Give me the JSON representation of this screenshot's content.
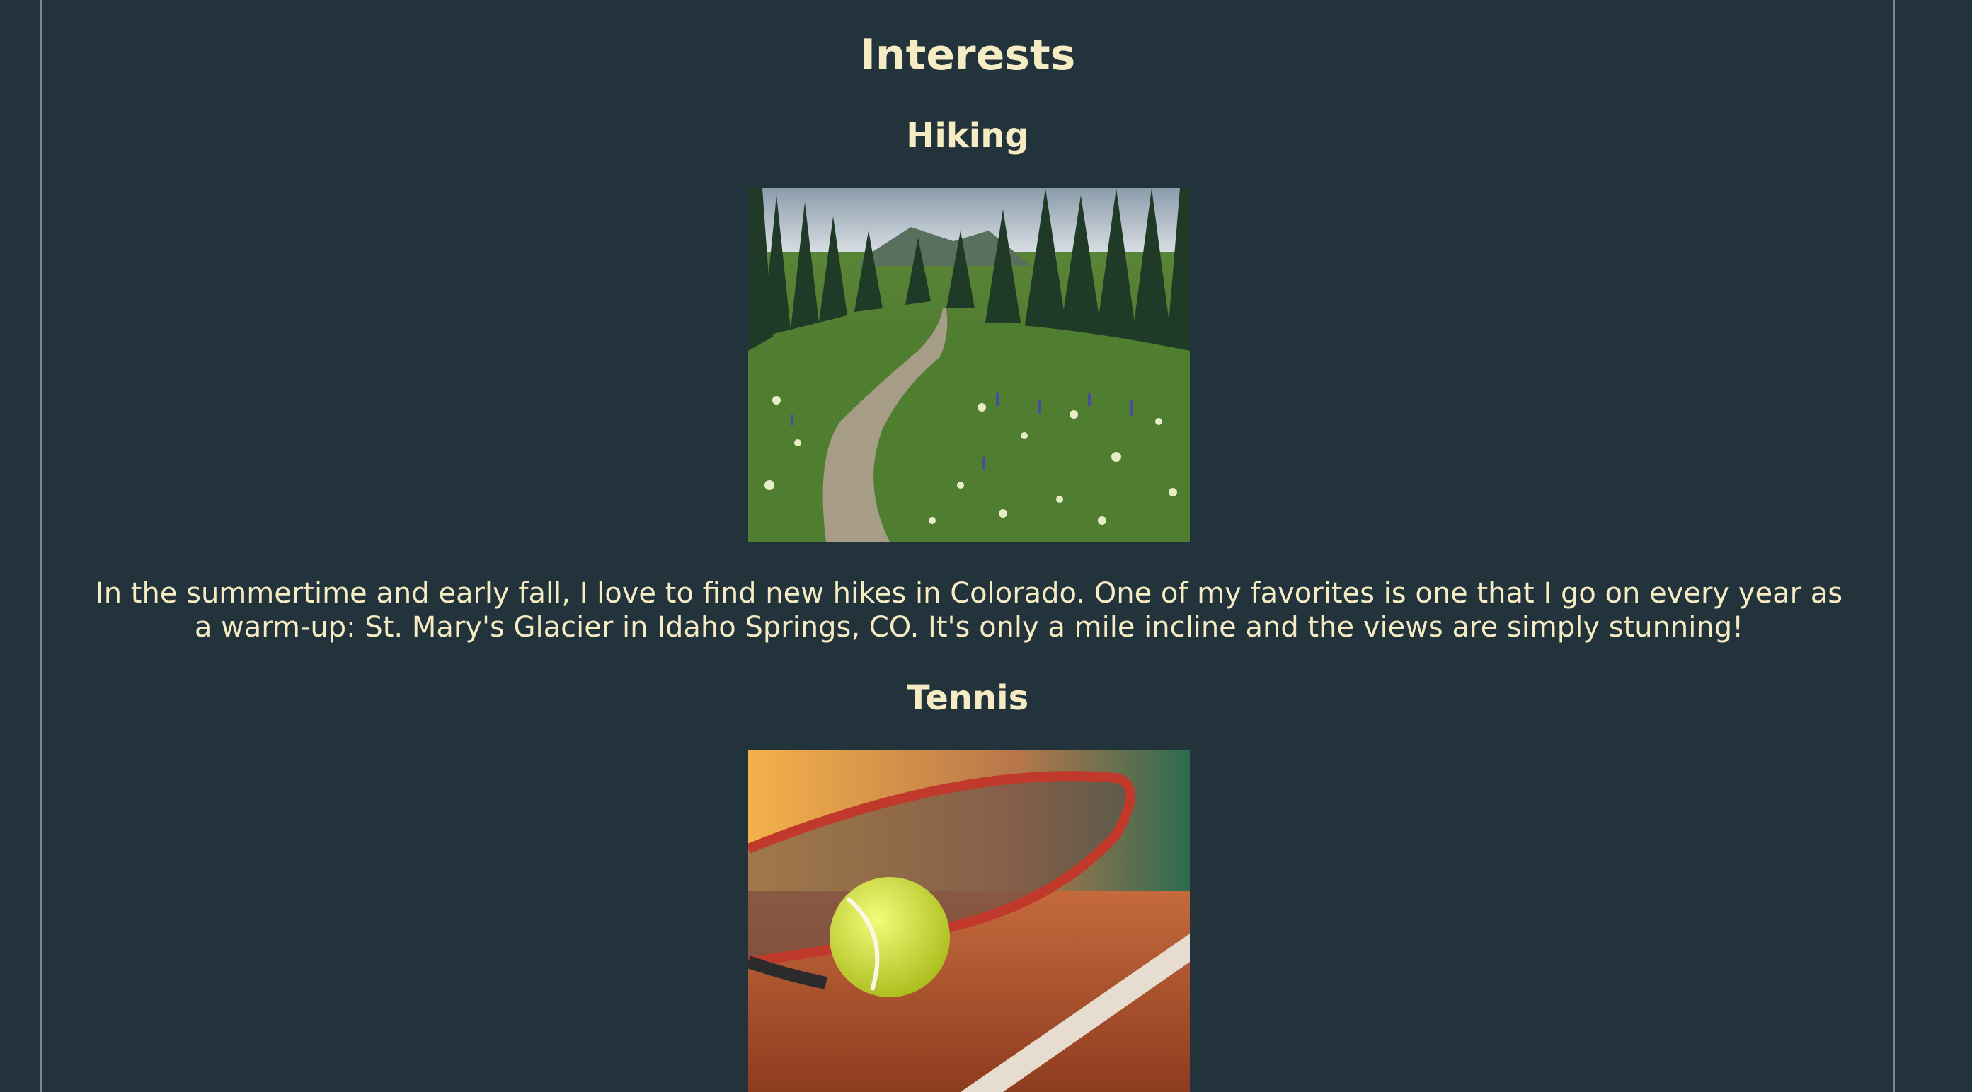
{
  "page": {
    "title": "Interests"
  },
  "sections": [
    {
      "heading": "Hiking",
      "image_subject": "mountain trail through wildflower meadow and pine forest",
      "text": "In the summertime and early fall, I love to find new hikes in Colorado. One of my favorites is one that I go on every year as a warm-up: St. Mary's Glacier in Idaho Springs, CO. It's only a mile incline and the views are simply stunning!"
    },
    {
      "heading": "Tennis",
      "image_subject": "tennis ball and racket on clay court"
    }
  ],
  "colors": {
    "background": "#22333b",
    "text": "#f5ecc4",
    "border": "#7c8a90"
  }
}
